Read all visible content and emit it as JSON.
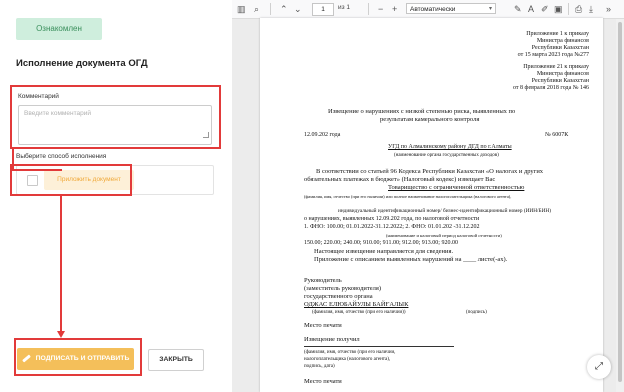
{
  "left_panel": {
    "acknowledged_label": "Ознакомлен",
    "heading": "Исполнение документа ОГД",
    "comment_label": "Комментарий",
    "comment_placeholder": "Введите комментарий",
    "method_label": "Выберите способ исполнения",
    "attach_label": "Приложить документ",
    "sign_label": "ПОДПИСАТЬ И ОТПРАВИТЬ",
    "close_label": "ЗАКРЫТЬ",
    "highlight_color": "#e23a3a",
    "sign_color": "#f4bf5a"
  },
  "viewer": {
    "current_page": "1",
    "page_total": "из 1",
    "zoom": "Автоматически",
    "icons": [
      "sidebar-toggle-icon",
      "search-icon",
      "page-up-icon",
      "page-down-icon",
      "zoom-out-icon",
      "zoom-in-icon",
      "highlight-icon",
      "text-icon",
      "draw-icon",
      "image-icon",
      "print-icon",
      "save-icon",
      "more-icon"
    ],
    "document": {
      "appendix1": [
        "Приложение 1 к приказу",
        "Министра финансов",
        "Республики Казахстан",
        "от 15 марта 2023 года №277"
      ],
      "appendix2": [
        "Приложение 21 к приказу",
        "Министра финансов",
        "Республики Казахстан",
        "от 8 февраля 2018 года № 146"
      ],
      "title": [
        "Извещение о нарушениях с низкой степенью риска, выявленных по",
        "результатам камерального контроля"
      ],
      "date": "12.09.202   года",
      "number": "№ 6007К",
      "issuer": "УГД по Алмалинскому району ДГД по г.Алматы",
      "issuer_caption": "(наименование органа государственных доходов)",
      "body_lines": [
        "В   соответствии  со  статьей  96  Кодекса  Республики  Казахстан  «О  налогах  и  других",
        "обязательных платежах в бюджет» (Налоговый кодекс)  извещает Вас",
        "Товарищество с ограниченной ответственностью"
      ],
      "taxpayer_caption": "(фамилия, имя, отчество (при его наличии) или полное наименование налогоплательщика (налогового агента),",
      "bin_line": "индивидуальный идентификационный номер/ бизнес-идентификационный номер (ИИН/БИН)",
      "violation_line": "о нарушениях, выявленных 12.09.202   года, по налоговой отчетности",
      "fno_line": "1. ФНО: 100.00; 01.01.2022-31.12.2022;  2. ФНО:   01.01.202  -31.12.202",
      "period_caption": "(наименование и налоговый период налоговой отчетности)",
      "codes_line": "150.00; 220.00; 240.00; 910.00; 911.00; 912.00; 913.00; 920.00",
      "info_line": "Настоящее извещение направляется для сведения.",
      "attach_line": "Приложение с описанием выявленных нарушений на ____ листе(-ах).",
      "head_lines": [
        "Руководитель",
        "(заместитель руководителя)",
        "государственного органа"
      ],
      "signer": "ОДЖАС ЕЛЮБАЙУЛЫ БАЙҒАЛЫК",
      "signer_caption": "(фамилия, имя, отчество (при его наличии))",
      "signature_caption": "(подпись)",
      "stamp": "Место печати",
      "received": "Извещение получил",
      "recipient_captions": [
        "(фамилия, имя, отчество (при его наличии,",
        "налогоплательщика (налогового агента),",
        "подпись, дата)"
      ],
      "stamp2": "Место печати"
    }
  }
}
